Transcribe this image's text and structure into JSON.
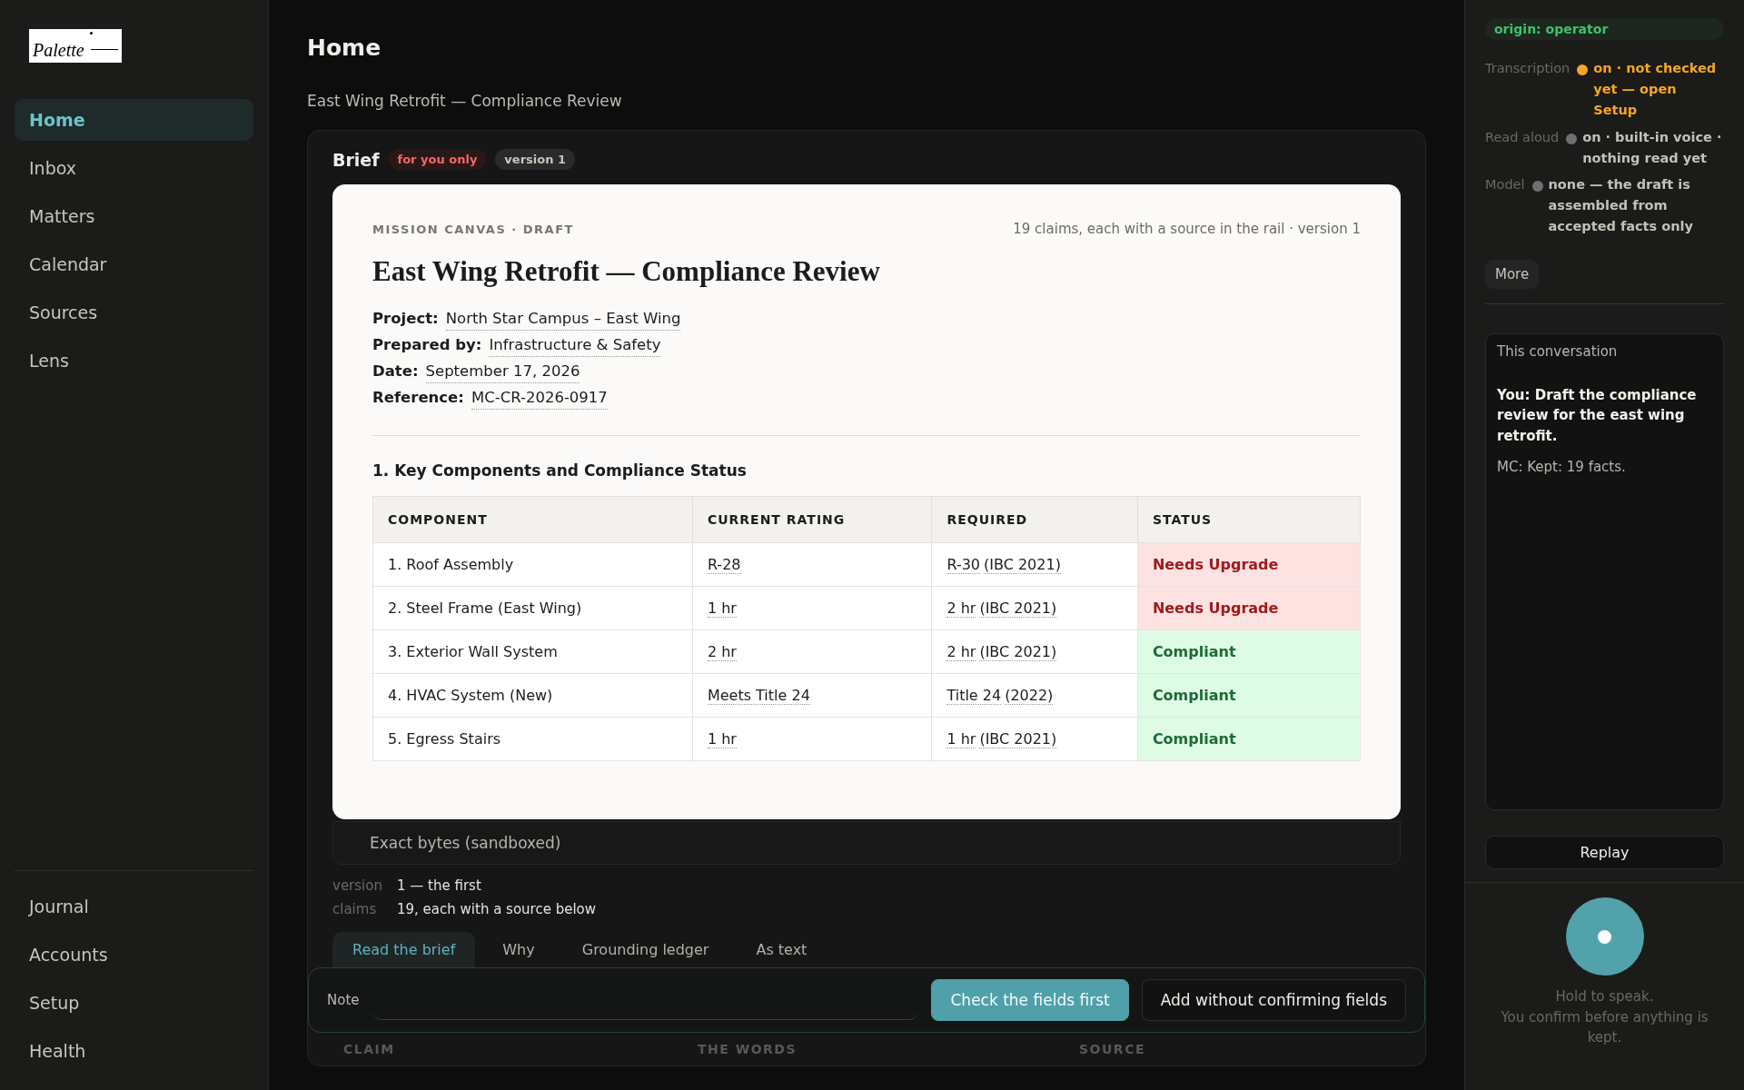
{
  "logo": {
    "text": "Palette"
  },
  "nav": [
    {
      "label": "Home",
      "selected": true
    },
    {
      "label": "Inbox",
      "selected": false
    },
    {
      "label": "Matters",
      "selected": false
    },
    {
      "label": "Calendar",
      "selected": false
    },
    {
      "label": "Sources",
      "selected": false
    },
    {
      "label": "Lens",
      "selected": false
    }
  ],
  "nav_bottom": [
    {
      "label": "Journal",
      "selected": false
    },
    {
      "label": "Accounts",
      "selected": false
    },
    {
      "label": "Setup",
      "selected": false
    },
    {
      "label": "Health",
      "selected": false
    }
  ],
  "page": {
    "title": "Home",
    "subtitle": "East Wing Retrofit — Compliance Review"
  },
  "brief": {
    "title": "Brief",
    "badges": [
      {
        "text": "for you only",
        "kind": "private"
      },
      {
        "text": "version 1",
        "kind": "neutral"
      }
    ],
    "document": {
      "eyebrow": "MISSION CANVAS · DRAFT",
      "meta": "19 claims, each with a source in the rail · version 1",
      "title": "East Wing Retrofit — Compliance Review",
      "fields": [
        {
          "label": "Project:",
          "value": "North Star Campus – East Wing"
        },
        {
          "label": "Prepared by:",
          "value": "Infrastructure & Safety"
        },
        {
          "label": "Date:",
          "value": "September 17, 2026"
        },
        {
          "label": "Reference:",
          "value": "MC-CR-2026-0917"
        }
      ],
      "section": "1. Key Components and Compliance Status",
      "table": {
        "columns": [
          "COMPONENT",
          "CURRENT RATING",
          "REQUIRED",
          "STATUS"
        ],
        "rows": [
          {
            "component": "1. Roof Assembly",
            "rating": "R-28",
            "required": "R-30",
            "basis": "(IBC 2021)",
            "status": "Needs Upgrade",
            "kind": "fail"
          },
          {
            "component": "2. Steel Frame (East Wing)",
            "rating": "1 hr",
            "required": "2 hr",
            "basis": "(IBC 2021)",
            "status": "Needs Upgrade",
            "kind": "fail"
          },
          {
            "component": "3. Exterior Wall System",
            "rating": "2 hr",
            "required": "2 hr",
            "basis": "(IBC 2021)",
            "status": "Compliant",
            "kind": "pass"
          },
          {
            "component": "4. HVAC System (New)",
            "rating": "Meets Title 24",
            "required": "Title 24",
            "basis": "(2022)",
            "status": "Compliant",
            "kind": "pass"
          },
          {
            "component": "5. Egress Stairs",
            "rating": "1 hr",
            "required": "1 hr",
            "basis": "(IBC 2021)",
            "status": "Compliant",
            "kind": "pass"
          }
        ]
      }
    },
    "raw_toggle": "Exact bytes (sandboxed)",
    "meta": [
      {
        "label": "version",
        "value": "1 — the first"
      },
      {
        "label": "claims",
        "value": "19, each with a source below"
      }
    ],
    "tabs": [
      {
        "label": "Read the brief",
        "selected": true
      },
      {
        "label": "Why",
        "selected": false
      },
      {
        "label": "Grounding ledger",
        "selected": false
      },
      {
        "label": "As text",
        "selected": false
      }
    ]
  },
  "action_bar": {
    "note_label": "Note",
    "primary": "Check the fields first",
    "secondary": "Add without confirming fields"
  },
  "ledger": {
    "columns": [
      "CLAIM",
      "THE WORDS",
      "SOURCE"
    ]
  },
  "rail": {
    "origin": "origin: operator",
    "status": [
      {
        "label": "Transcription",
        "value": "on · not checked yet — open Setup",
        "kind": "warning"
      },
      {
        "label": "Read aloud",
        "value": "on · built-in voice · nothing read yet",
        "kind": "idle"
      },
      {
        "label": "Model",
        "value": "none — the draft is assembled from accepted facts only",
        "kind": "idle"
      }
    ],
    "more": "More",
    "conversation": {
      "title": "This conversation",
      "messages": [
        {
          "text": "You: Draft the compliance review for the east wing retrofit.",
          "kind": "user"
        },
        {
          "text": "MC: Kept: 19 facts.",
          "kind": "assistant"
        }
      ]
    },
    "replay": "Replay",
    "mic_hint": [
      "Hold to speak.",
      "You confirm before anything is kept."
    ]
  }
}
